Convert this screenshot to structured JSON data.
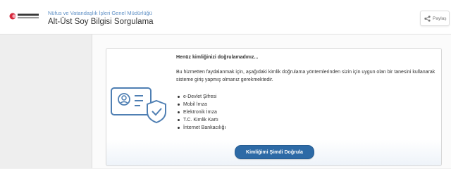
{
  "header": {
    "logo_alt": "NÜFUS ve VATANDAŞLIK",
    "organization": "Nüfus ve Vatandaşlık İşleri Genel Müdürlüğü",
    "service_title": "Alt-Üst Soy Bilgisi Sorgulama",
    "share_label": "Paylaş"
  },
  "card": {
    "heading": "Henüz kimliğinizi doğrulamadınız...",
    "description": "Bu hizmetten faydalanmak için, aşağıdaki kimlik doğrulama yöntemlerinden sizin için uygun olan bir tanesini kullanarak sisteme giriş yapmış olmanız gerekmektedir.",
    "methods": [
      "e-Devlet Şifresi",
      "Mobil İmza",
      "Elektronik İmza",
      "T.C. Kimlik Kartı",
      "İnternet Bankacılığı"
    ],
    "button_label": "Kimliğimi Şimdi Doğrula"
  },
  "colors": {
    "accent": "#2d6aa6",
    "org_text": "#5c8ec4",
    "icon_blue": "#4f7fb3",
    "logo_red": "#d6283c"
  }
}
